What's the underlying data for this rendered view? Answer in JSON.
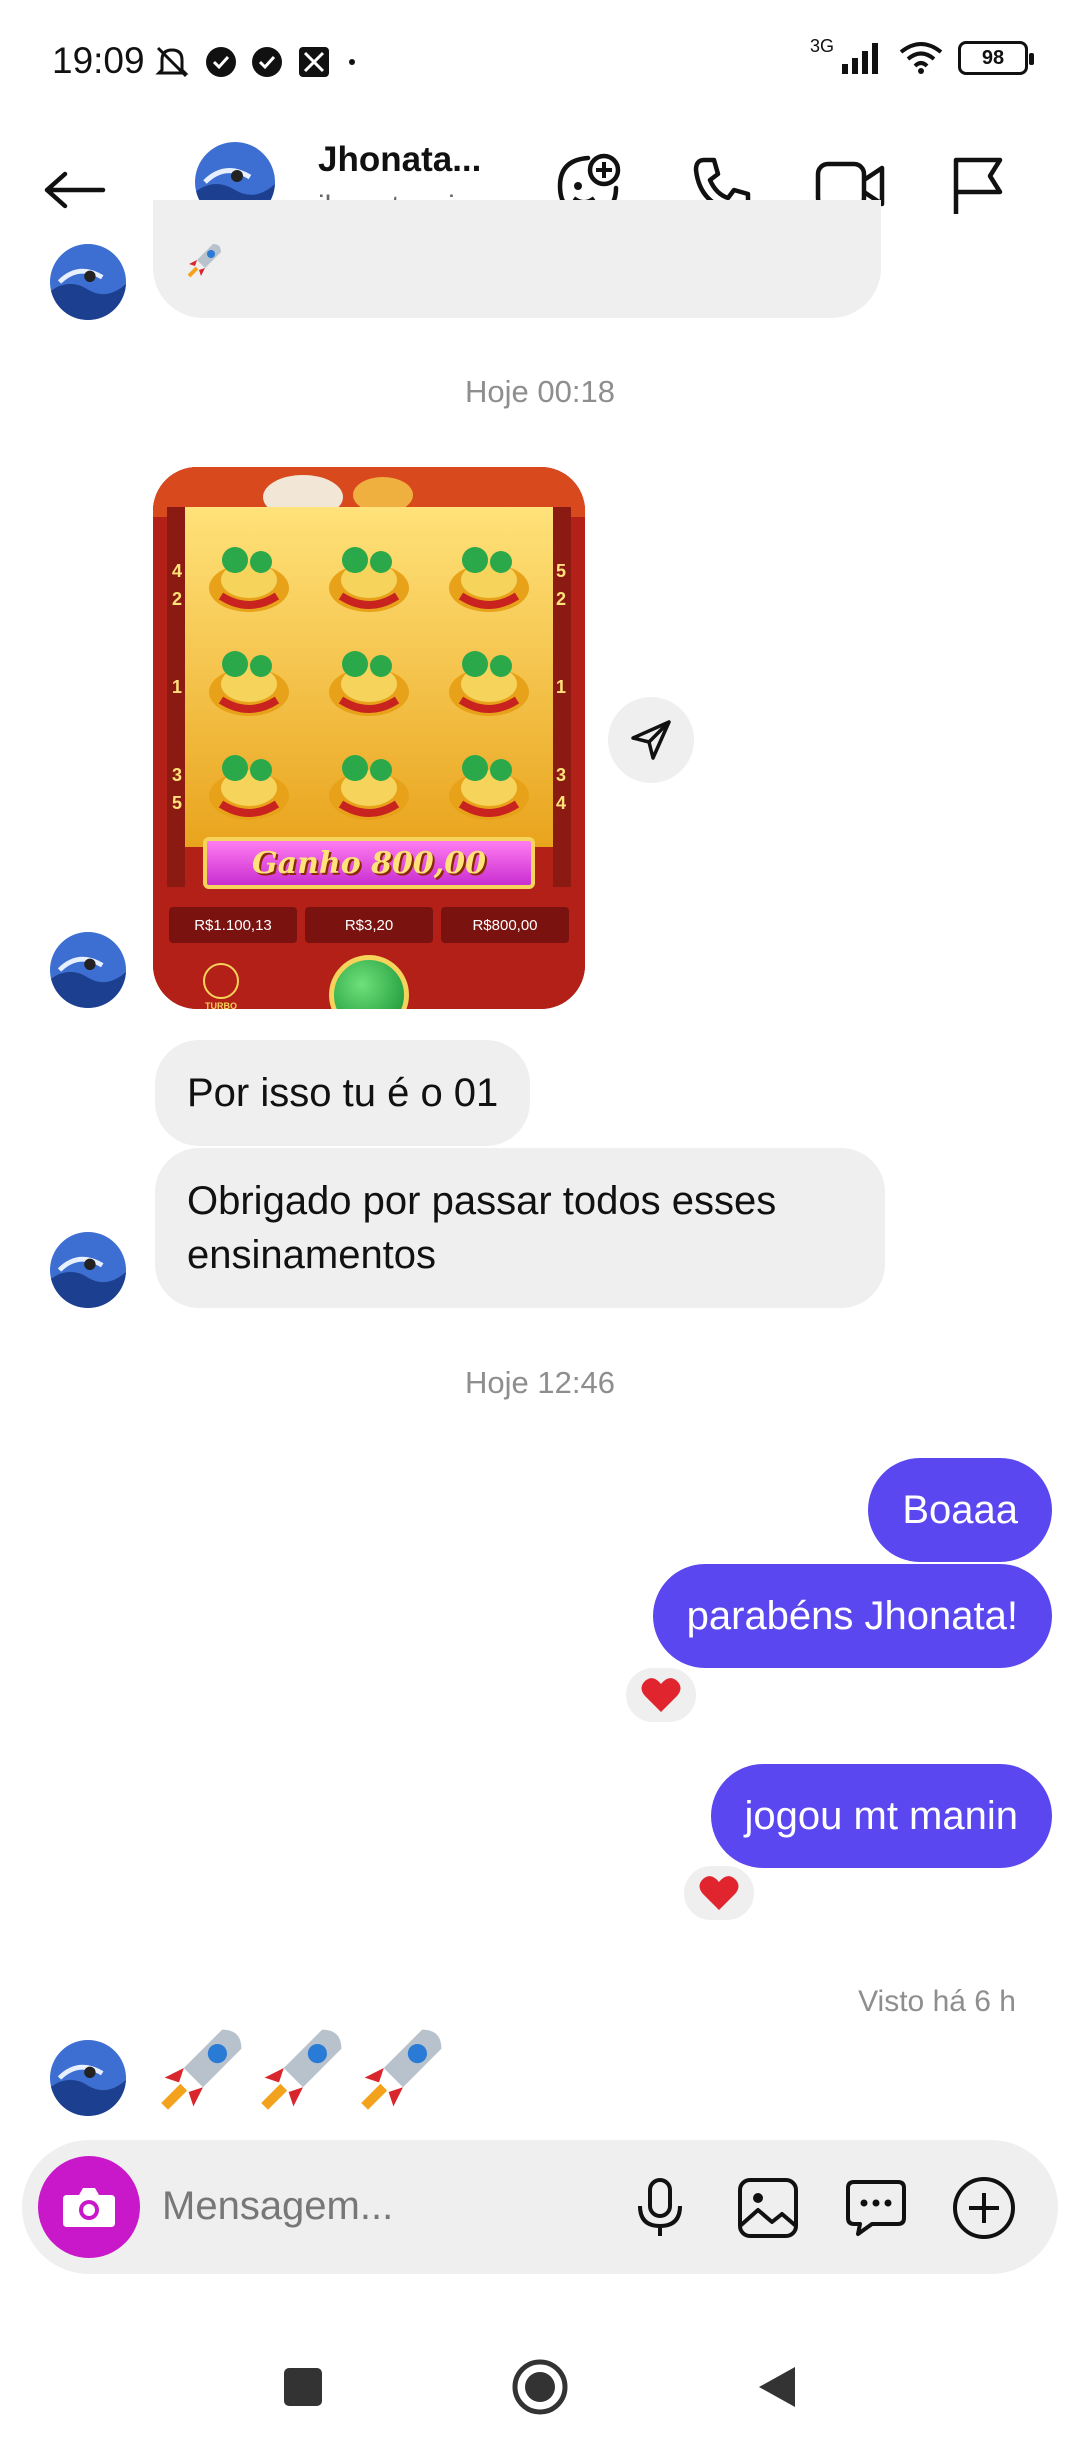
{
  "status_bar": {
    "time": "19:09",
    "network_label": "3G",
    "battery_level": "98"
  },
  "header": {
    "contact_name": "Jhonata...",
    "contact_username": "jhonata_si..."
  },
  "messages": {
    "timestamp_1": "Hoje 00:18",
    "slot_image": {
      "win_label": "Ganho 800,00",
      "balance": "R$1.100,13",
      "bet": "R$3,20",
      "win": "R$800,00",
      "turbo_label": "TURBO",
      "reel_numbers_left": [
        "4",
        "2",
        "1",
        "3",
        "5"
      ],
      "reel_numbers_right": [
        "5",
        "2",
        "1",
        "3",
        "4"
      ]
    },
    "in_1": "Por isso tu é o 01",
    "in_2": "Obrigado por passar todos esses ensinamentos",
    "timestamp_2": "Hoje 12:46",
    "out_1": "Boaaa",
    "out_2": "parabéns Jhonata!",
    "out_3": "jogou mt manin",
    "seen_label": "Visto há 6 h",
    "emoji_message": "🚀🚀🚀"
  },
  "composer": {
    "placeholder": "Mensagem..."
  },
  "colors": {
    "outgoing_bubble": "#5b47f0",
    "incoming_bubble": "#efefef",
    "camera_button": "#c918c9",
    "reaction_heart": "#e0252f"
  }
}
